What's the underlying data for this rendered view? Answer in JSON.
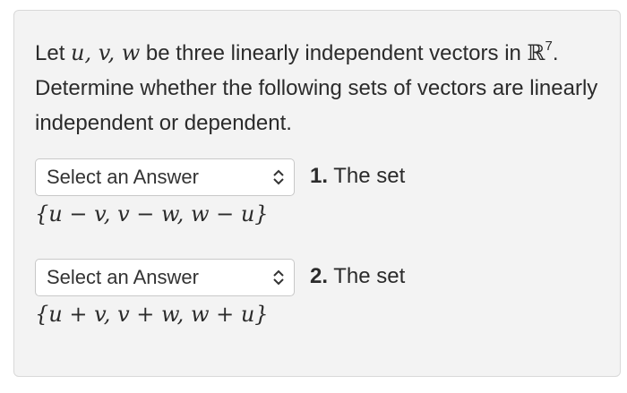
{
  "intro": {
    "part1": "Let ",
    "vars": "u, v, w",
    "part2": " be three linearly independent vectors in ",
    "space": "ℝ",
    "exp": "7",
    "part3": ". Determine whether the following sets of vectors are linearly independent or dependent."
  },
  "questions": [
    {
      "select_value": "Select an Answer",
      "number": "1.",
      "label": " The set",
      "set": "{u − v, v − w, w − u}"
    },
    {
      "select_value": "Select an Answer",
      "number": "2.",
      "label": " The set",
      "set": "{u + v, v + w, w + u}"
    }
  ]
}
